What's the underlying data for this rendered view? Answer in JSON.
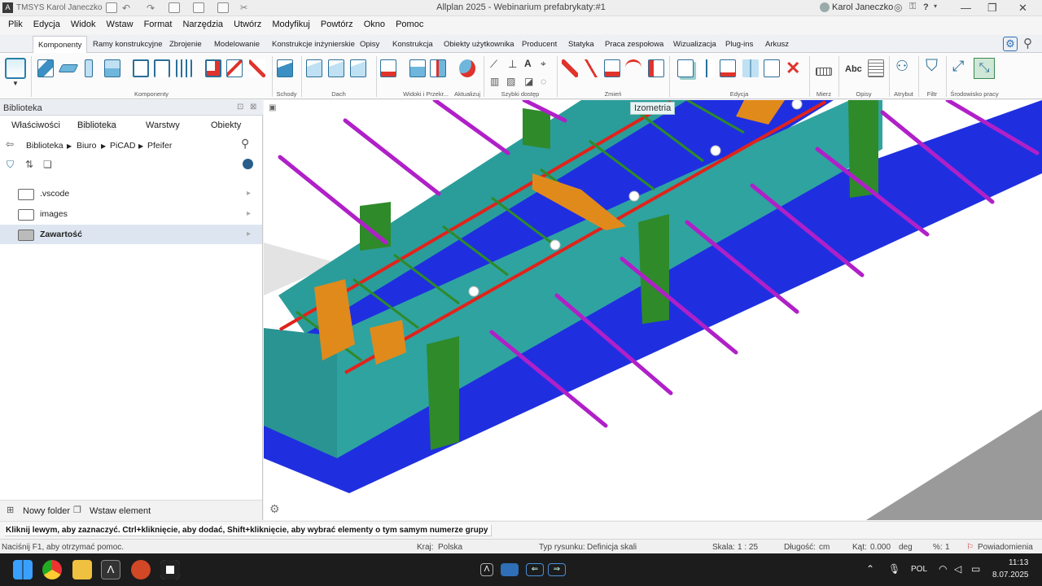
{
  "title_bar": {
    "left_text": "TMSYS Karol Janeczko",
    "title": "Allplan 2025 - Webinarium prefabrykaty:#1",
    "user": "Karol Janeczko",
    "help": "?"
  },
  "menu": [
    "Plik",
    "Edycja",
    "Widok",
    "Wstaw",
    "Format",
    "Narzędzia",
    "Utwórz",
    "Modyfikuj",
    "Powtórz",
    "Okno",
    "Pomoc"
  ],
  "ribbon_tabs": [
    "Komponenty",
    "Ramy konstrukcyjne",
    "Zbrojenie",
    "Modelowanie",
    "Konstrukcje inżynierskie",
    "Opisy",
    "Konstrukcja",
    "Obiekty użytkownika",
    "Producent",
    "Statyka",
    "Praca zespołowa",
    "Wizualizacja",
    "Plug-ins",
    "Arkusz"
  ],
  "ribbon_groups": [
    "Komponenty",
    "Schody",
    "Dach",
    "Widoki i Przekr...",
    "Aktualizuj",
    "Szybki dostęp",
    "Zmień",
    "Edycja",
    "Mierz",
    "Opisy",
    "Atrybut",
    "Filtr",
    "Środowisko pracy"
  ],
  "ribbon_text_icons": {
    "abc": "Abc"
  },
  "library": {
    "title": "Biblioteka",
    "tabs": [
      "Właściwości",
      "Biblioteka",
      "Warstwy",
      "Obiekty"
    ],
    "breadcrumb": [
      "Biblioteka",
      "Biuro",
      "PiCAD",
      "Pfeifer"
    ],
    "items": [
      {
        "label": ".vscode",
        "selected": false
      },
      {
        "label": "images",
        "selected": false
      },
      {
        "label": "Zawartość",
        "selected": true
      }
    ],
    "footer": {
      "new_folder": "Nowy folder",
      "insert": "Wstaw element"
    }
  },
  "viewport": {
    "view_label": "Izometria"
  },
  "hint": "Kliknij lewym, aby zaznaczyć. Ctrl+kliknięcie, aby dodać, Shift+kliknięcie, aby wybrać elementy o tym samym numerze grupy",
  "status": {
    "help": "Naciśnij F1, aby otrzymać pomoc.",
    "country_label": "Kraj:",
    "country": "Polska",
    "drawing_type_label": "Typ rysunku:",
    "drawing_type": "Definicja skali",
    "scale_label": "Skala:",
    "scale": "1 : 25",
    "length_label": "Długość:",
    "length": "cm",
    "angle_label": "Kąt:",
    "angle": "0.000",
    "angle_unit": "deg",
    "percent_label": "%:",
    "percent": "1",
    "notifications": "Powiadomienia"
  },
  "taskbar": {
    "lang": "POL",
    "time": "11:13",
    "date": "8.07.2025"
  },
  "colors": {
    "accent": "#2e6fb7",
    "teal": "#2a9d9a",
    "blue": "#1f2fe0",
    "magenta": "#b020c8",
    "red": "#e0231b",
    "green": "#2f8a2a",
    "orange": "#e08a1c"
  }
}
